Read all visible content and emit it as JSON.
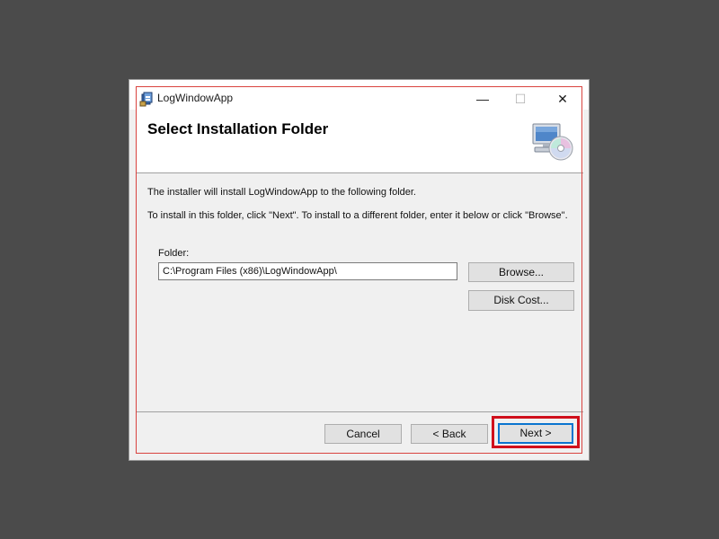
{
  "window": {
    "title": "LogWindowApp",
    "controls": {
      "minimize": "—",
      "maximize": "☐",
      "close": "✕"
    }
  },
  "header": {
    "title": "Select Installation Folder",
    "icon": "computer-disc-icon"
  },
  "body": {
    "line1": "The installer will install LogWindowApp to the following folder.",
    "line2": "To install in this folder, click \"Next\". To install to a different folder, enter it below or click \"Browse\".",
    "folder_label": "Folder:",
    "folder_value": "C:\\Program Files (x86)\\LogWindowApp\\",
    "browse_label": "Browse...",
    "disk_cost_label": "Disk Cost..."
  },
  "footer": {
    "cancel_label": "Cancel",
    "back_label": "< Back",
    "next_label": "Next >"
  },
  "colors": {
    "highlight": "#d0101c",
    "focus": "#0a74cf",
    "backdrop": "#4b4b4b"
  }
}
